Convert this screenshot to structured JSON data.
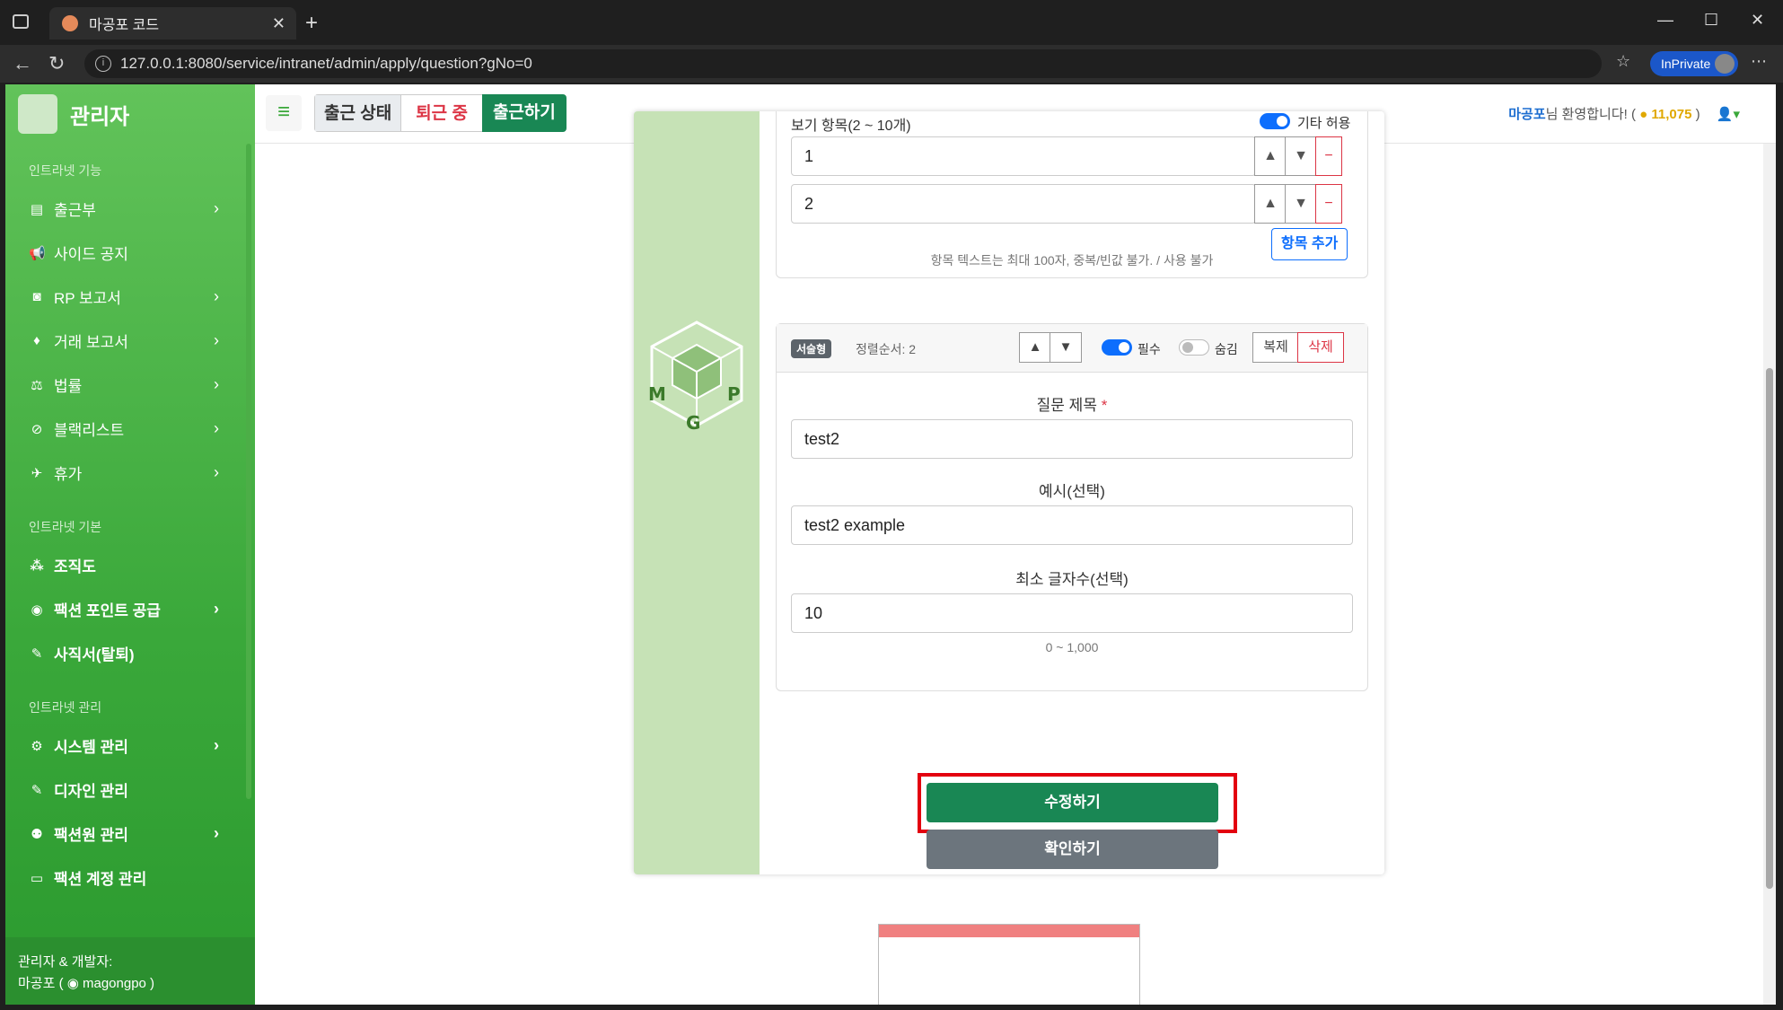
{
  "browser": {
    "tab_title": "마공포 코드",
    "url": "127.0.0.1:8080/service/intranet/admin/apply/question?gNo=0",
    "inprivate_label": "InPrivate"
  },
  "sidebar": {
    "brand": "관리자",
    "sections": [
      {
        "title": "인트라넷 기능",
        "items": [
          {
            "label": "출근부",
            "icon": "book-icon",
            "chevron": true
          },
          {
            "label": "사이드 공지",
            "icon": "megaphone-icon",
            "chevron": false
          },
          {
            "label": "RP 보고서",
            "icon": "gamepad-icon",
            "chevron": true
          },
          {
            "label": "거래 보고서",
            "icon": "money-bag-icon",
            "chevron": true
          },
          {
            "label": "법률",
            "icon": "scale-icon",
            "chevron": true
          },
          {
            "label": "블랙리스트",
            "icon": "ban-icon",
            "chevron": true
          },
          {
            "label": "휴가",
            "icon": "plane-icon",
            "chevron": true
          }
        ]
      },
      {
        "title": "인트라넷 기본",
        "items": [
          {
            "label": "조직도",
            "icon": "sitemap-icon",
            "chevron": false
          },
          {
            "label": "팩션 포인트 공급",
            "icon": "coins-icon",
            "chevron": true
          },
          {
            "label": "사직서(탈퇴)",
            "icon": "feather-icon",
            "chevron": false
          }
        ]
      },
      {
        "title": "인트라넷 관리",
        "items": [
          {
            "label": "시스템 관리",
            "icon": "gear-icon",
            "chevron": true
          },
          {
            "label": "디자인 관리",
            "icon": "pen-icon",
            "chevron": false
          },
          {
            "label": "팩션원 관리",
            "icon": "user-gear-icon",
            "chevron": true
          },
          {
            "label": "팩션 계정 관리",
            "icon": "id-card-icon",
            "chevron": false
          }
        ]
      }
    ],
    "footer_line1": "관리자 & 개발자:",
    "footer_line2": "마공포 ( ",
    "footer_discord": "magongpo )"
  },
  "topbar": {
    "status_label": "출근 상태",
    "status_value": "퇴근 중",
    "checkin_button": "출근하기",
    "welcome_name": "마공포",
    "welcome_text": "님 환영합니다! (",
    "coin_amount": "11,075",
    "welcome_close": ")"
  },
  "question1": {
    "options_label": "보기 항목(2 ~ 10개)",
    "allow_other_label": "기타 허용",
    "options": [
      "1",
      "2"
    ],
    "add_option_button": "항목 추가",
    "hint": "항목 텍스트는 최대 100자, 중복/빈값 불가. / 사용 불가"
  },
  "question2": {
    "type_badge": "서술형",
    "order_text": "정렬순서: 2",
    "required_label": "필수",
    "hidden_label": "숨김",
    "copy_button": "복제",
    "delete_button": "삭제",
    "title_label": "질문 제목",
    "title_required_mark": "*",
    "title_value": "test2",
    "example_label": "예시(선택)",
    "example_value": "test2 example",
    "min_chars_label": "최소 글자수(선택)",
    "min_chars_value": "10",
    "min_chars_range": "0 ~ 1,000"
  },
  "actions": {
    "modify_button": "수정하기",
    "confirm_button": "확인하기"
  },
  "colors": {
    "sidebar_green": "#3aa83a",
    "primary_green": "#198754",
    "danger_red": "#dc3545",
    "highlight_red": "#e3000f"
  }
}
